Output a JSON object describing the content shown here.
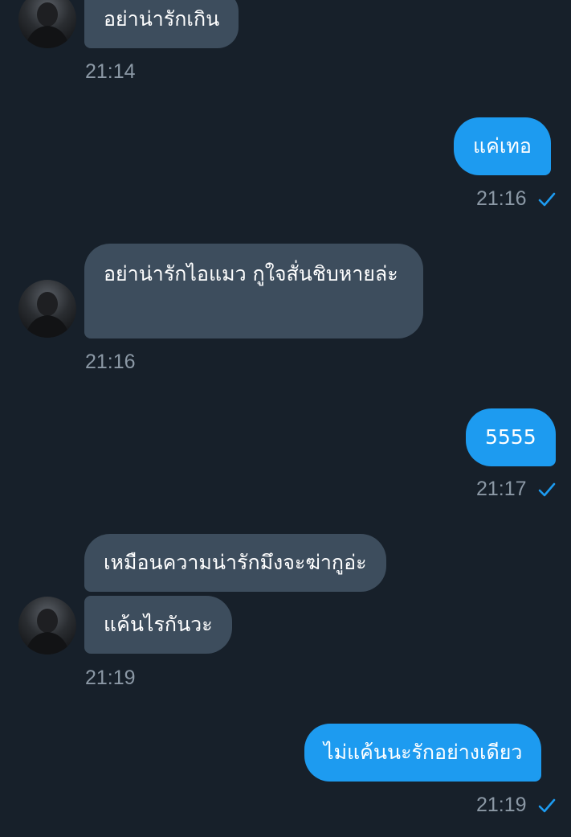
{
  "colors": {
    "background": "#17202a",
    "incoming_bubble": "#3d4d5d",
    "outgoing_bubble": "#1d9bf0",
    "timestamp": "#8b98a5",
    "read_check": "#1d9bf0"
  },
  "messages": [
    {
      "side": "in",
      "text": "อย่าน่ารักเกิน",
      "time": "21:14"
    },
    {
      "side": "out",
      "text": "แค่เทอ",
      "time": "21:16",
      "status_icon": "read-check-icon"
    },
    {
      "side": "in",
      "text": "อย่าน่ารักไอแมว กูใจสั่นชิบหายล่ะ",
      "time": "21:16"
    },
    {
      "side": "out",
      "text": "5555",
      "time": "21:17",
      "status_icon": "read-check-icon"
    },
    {
      "side": "in",
      "text": "เหมือนความน่ารักมึงจะฆ่ากูอ่ะ"
    },
    {
      "side": "in",
      "text": "แค้นไรกันวะ",
      "time": "21:19"
    },
    {
      "side": "out",
      "text": "ไม่แค้นนะรักอย่างเดียว",
      "time": "21:19",
      "status_icon": "read-check-icon"
    }
  ]
}
